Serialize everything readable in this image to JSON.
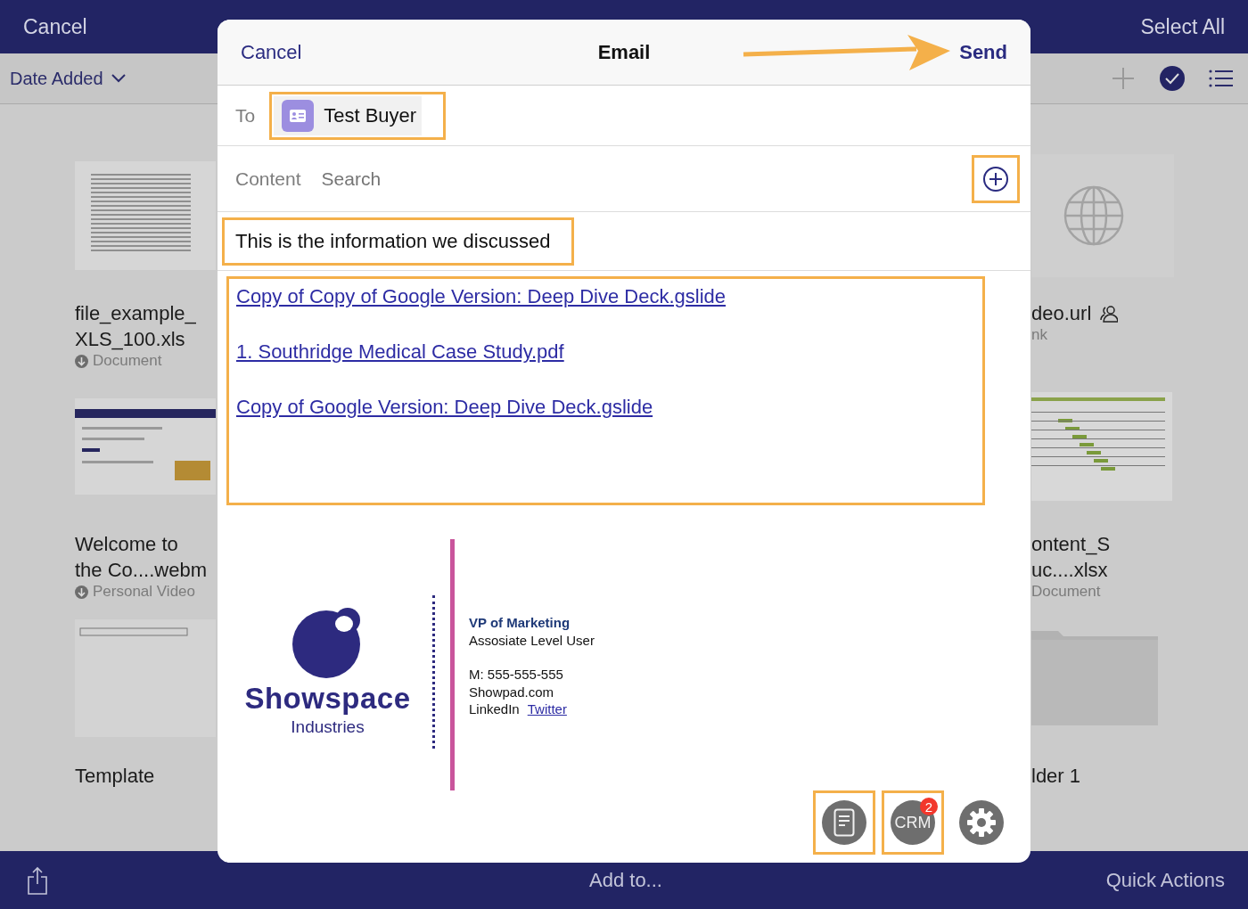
{
  "app_bar": {
    "cancel": "Cancel",
    "select_all": "Select All"
  },
  "toolbar": {
    "sort": "Date Added"
  },
  "files_left": [
    {
      "kind": "spreadsheet",
      "name_lines": [
        "file_example_",
        "XLS_100.xls"
      ],
      "type": "Document",
      "downloaded": true,
      "shared": false
    },
    {
      "kind": "webpage",
      "name_lines": [
        "Welcome to",
        "the Co....webm"
      ],
      "type": "Personal Video",
      "downloaded": true,
      "shared": false
    },
    {
      "kind": "document",
      "name_lines": [
        "Template"
      ],
      "shared": false
    }
  ],
  "files_right": [
    {
      "kind": "link",
      "name_lines": [
        "deo.url"
      ],
      "type": "nk",
      "downloaded": false,
      "shared": true
    },
    {
      "kind": "gantt",
      "name_lines": [
        "ontent_S",
        "uc....xlsx"
      ],
      "type": "Document",
      "downloaded": false,
      "shared": false
    },
    {
      "kind": "folder",
      "name_lines": [
        "lder 1"
      ],
      "shared": false
    }
  ],
  "email": {
    "cancel": "Cancel",
    "title": "Email",
    "send": "Send",
    "to_label": "To",
    "recipient": "Test Buyer",
    "content_label": "Content",
    "search_placeholder": "Search",
    "message": "This is the information we discussed",
    "links": [
      "Copy of Copy of Google Version: Deep Dive Deck.gslide",
      "1. Southridge Medical Case Study.pdf",
      "Copy of Google Version: Deep Dive Deck.gslide"
    ],
    "signature": {
      "company": "Showspace",
      "division": "Industries",
      "title": "VP of Marketing",
      "role": "Assosiate Level User",
      "mobile": "M: 555-555-555",
      "website": "Showpad.com",
      "linkedin": "LinkedIn",
      "twitter": "Twitter"
    },
    "highlights": {
      "send": true,
      "recipient": true,
      "add_content": true,
      "message": true,
      "links": true
    },
    "actions": [
      {
        "kind": "document",
        "highlighted": true
      },
      {
        "kind": "crm",
        "label": "CRM",
        "badge": "2",
        "highlighted": true
      },
      {
        "kind": "settings",
        "highlighted": false
      }
    ]
  },
  "bottom_bar": {
    "add_to": "Add to...",
    "quick_actions": "Quick Actions"
  }
}
